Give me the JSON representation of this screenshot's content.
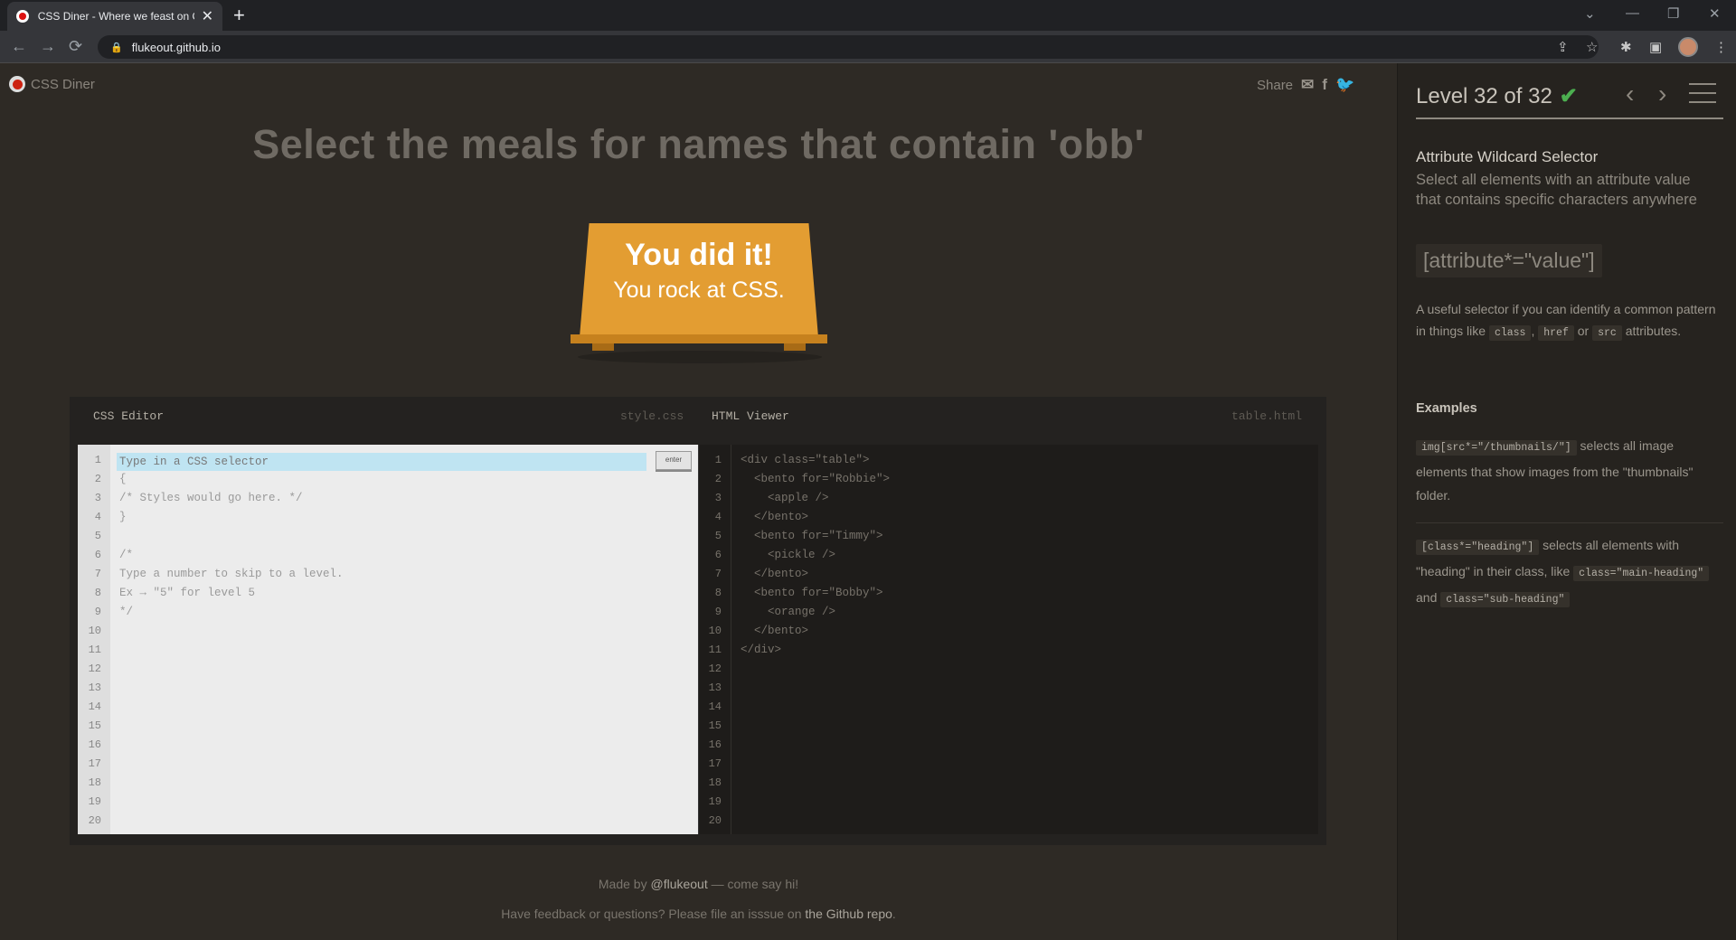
{
  "browser": {
    "tab_title": "CSS Diner - Where we feast on C",
    "tab_close": "✕",
    "new_tab": "+",
    "url": "flukeout.github.io",
    "back": "←",
    "forward": "→",
    "reload": "⟳",
    "lock": "🔒",
    "share_icon": "⇪",
    "star_icon": "☆",
    "extensions_icon": "✱",
    "sidepanel_icon": "▣",
    "menu_icon": "⋮",
    "win_down": "⌄",
    "win_min": "—",
    "win_restore": "❐",
    "win_close": "✕"
  },
  "header": {
    "logo_text": "CSS Diner",
    "share_label": "Share",
    "share_icons": {
      "email": "✉",
      "facebook": "f",
      "twitter": "🐦"
    }
  },
  "main": {
    "order": "Select the meals for names that contain 'obb'",
    "win_line1": "You did it!",
    "win_line2": "You rock at CSS."
  },
  "css_editor": {
    "title": "CSS Editor",
    "file": "style.css",
    "placeholder": "Type in a CSS selector",
    "enter_label": "enter",
    "line_numbers": "1\n2\n3\n4\n5\n6\n7\n8\n9\n10\n11\n12\n13\n14\n15\n16\n17\n18\n19\n20",
    "code": "\n{\n/* Styles would go here. */\n}\n\n/*\nType a number to skip to a level.\nEx → \"5\" for level 5\n*/"
  },
  "html_viewer": {
    "title": "HTML Viewer",
    "file": "table.html",
    "line_numbers": "1\n2\n3\n4\n5\n6\n7\n8\n9\n10\n11\n12\n13\n14\n15\n16\n17\n18\n19\n20",
    "code": "<div class=\"table\">\n  <bento for=\"Robbie\">\n    <apple />\n  </bento>\n  <bento for=\"Timmy\">\n    <pickle />\n  </bento>\n  <bento for=\"Bobby\">\n    <orange />\n  </bento>\n</div>"
  },
  "footer": {
    "made_by": "Made by",
    "author": "@flukeout",
    "say_hi": "— come say hi!",
    "feedback": "Have feedback or questions? Please file an isssue on",
    "repo_link": "the Github repo",
    "period": "."
  },
  "sidebar": {
    "level_label": "Level 32 of 32",
    "check": "✔",
    "prev": "‹",
    "next": "›",
    "progress": 1.0,
    "selector_name": "Attribute Wildcard Selector",
    "selector_title": "Select all elements with an attribute value that contains specific characters anywhere",
    "syntax": "[attribute*=\"value\"]",
    "hint_pre": "A useful selector if you can identify a common pattern in things like",
    "hint_class": "class",
    "hint_comma": ",",
    "hint_href": "href",
    "hint_or": "or",
    "hint_src": "src",
    "hint_post": "attributes.",
    "examples_title": "Examples",
    "ex1_code": "img[src*=\"/thumbnails/\"]",
    "ex1_text": "selects all image elements that show images from the \"thumbnails\" folder.",
    "ex2_code": "[class*=\"heading\"]",
    "ex2_text1": "selects all elements with \"heading\" in their class, like",
    "ex2_code2": "class=\"main-heading\"",
    "ex2_and": "and",
    "ex2_code3": "class=\"sub-heading\""
  }
}
